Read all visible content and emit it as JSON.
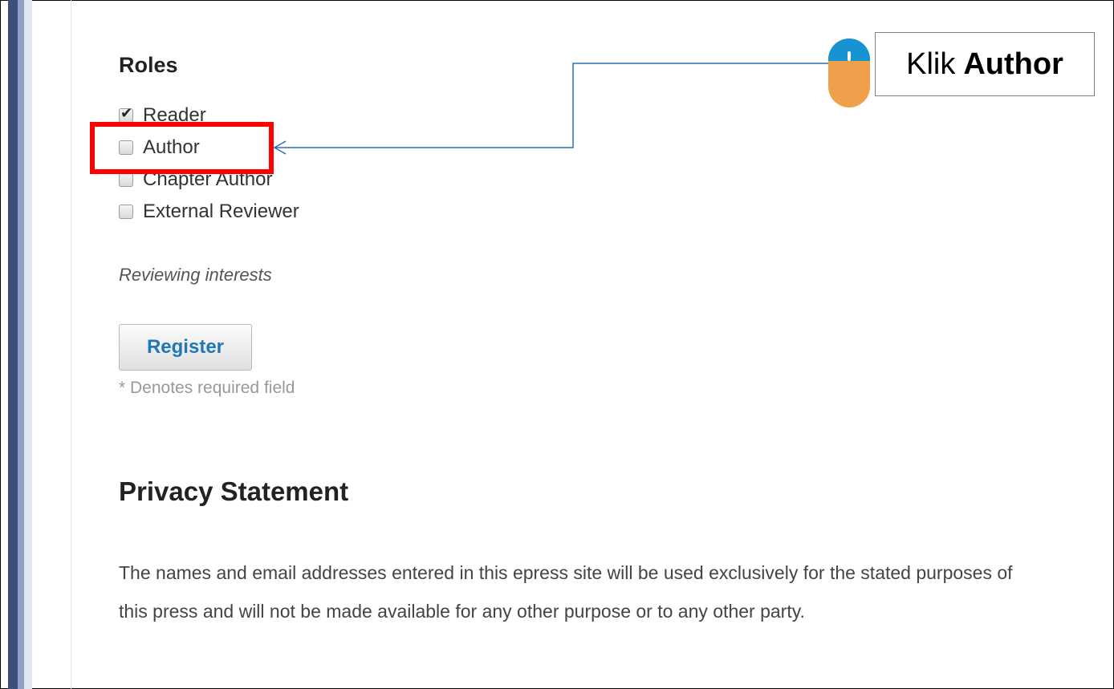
{
  "roles": {
    "heading": "Roles",
    "items": [
      {
        "label": "Reader",
        "checked": true
      },
      {
        "label": "Author",
        "checked": false
      },
      {
        "label": "Chapter Author",
        "checked": false
      },
      {
        "label": "External Reviewer",
        "checked": false
      }
    ]
  },
  "reviewing_label": "Reviewing interests",
  "register_label": "Register",
  "required_note": "* Denotes required field",
  "privacy": {
    "heading": "Privacy Statement",
    "text": "The names and email addresses entered in this epress site will be used exclusively for the stated purposes of this press and will not be made available for any other purpose or to any other party."
  },
  "callout": {
    "prefix": "Klik",
    "target": "Author"
  },
  "icons": {
    "checkmark": "check-icon",
    "mouse": "mouse-icon",
    "arrow": "arrow-icon"
  },
  "colors": {
    "highlight": "#ff0000",
    "connector": "#2e6db4",
    "register_text": "#1f78b4",
    "mouse_top": "#1793d1",
    "mouse_bottom": "#f0a04b"
  }
}
